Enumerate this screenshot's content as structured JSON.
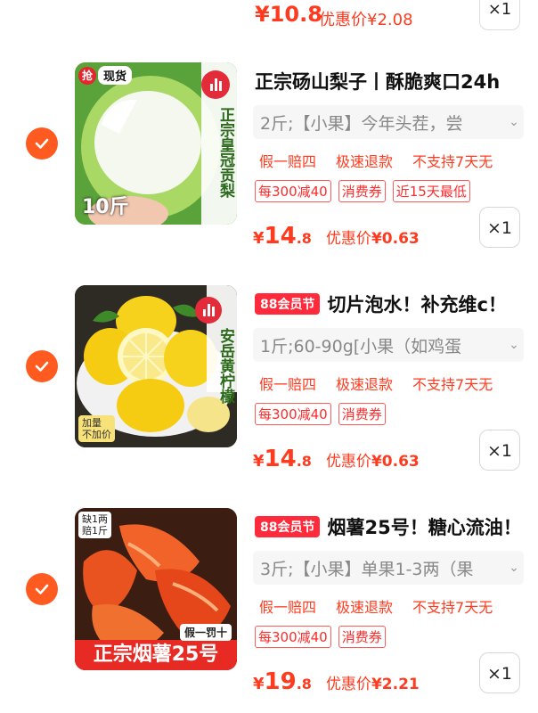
{
  "top_partial": {
    "price": "¥10.8",
    "deal": "优惠价¥2.08",
    "qty": "×1"
  },
  "colors": {
    "accent": "#ff3b1f",
    "check": "#ff5a1f",
    "tag88": "#ff2a3b"
  },
  "items": [
    {
      "title": "正宗砀山梨子丨酥脆爽口24h",
      "tag88": "",
      "spec": "2斤;【小果】今年头茬，尝",
      "services": [
        "假一赔四",
        "极速退款",
        "不支持7天无"
      ],
      "coupons": [
        "每300减40",
        "消费券",
        "近15天最低"
      ],
      "price_cur": "¥",
      "price_int": "14",
      "price_dec": ".8",
      "deal_label": "优惠价",
      "deal_cur": "¥",
      "deal_val": "0.63",
      "qty": "×1",
      "image": {
        "badge": "抢",
        "badge2": "现货",
        "side_text": "正宗皇冠贡梨",
        "weight": "10斤",
        "icon": "pear-icon"
      }
    },
    {
      "title": "切片泡水！补充维c！",
      "tag88": "88会员节",
      "spec": "1斤;60-90g[小果（如鸡蛋",
      "services": [
        "假一赔四",
        "极速退款",
        "不支持7天无"
      ],
      "coupons": [
        "每300减40",
        "消费券"
      ],
      "price_cur": "¥",
      "price_int": "14",
      "price_dec": ".8",
      "deal_label": "优惠价",
      "deal_cur": "¥",
      "deal_val": "0.63",
      "qty": "×1",
      "image": {
        "side_text": "安岳黄柠檬",
        "corner": "加量\n不加价",
        "icon": "lemon-icon"
      }
    },
    {
      "title": "烟薯25号！糖心流油！",
      "tag88": "88会员节",
      "spec": "3斤;【小果】单果1-3两（果",
      "services": [
        "假一赔四",
        "极速退款",
        "不支持7天无"
      ],
      "coupons": [
        "每300减40",
        "消费券"
      ],
      "price_cur": "¥",
      "price_int": "19",
      "price_dec": ".8",
      "deal_label": "优惠价",
      "deal_cur": "¥",
      "deal_val": "2.21",
      "qty": "×1",
      "image": {
        "corner": "缺1两\n赔1斤",
        "tag": "假一罚十",
        "banner": "正宗烟薯25号",
        "icon": "sweet-potato-icon"
      }
    }
  ]
}
